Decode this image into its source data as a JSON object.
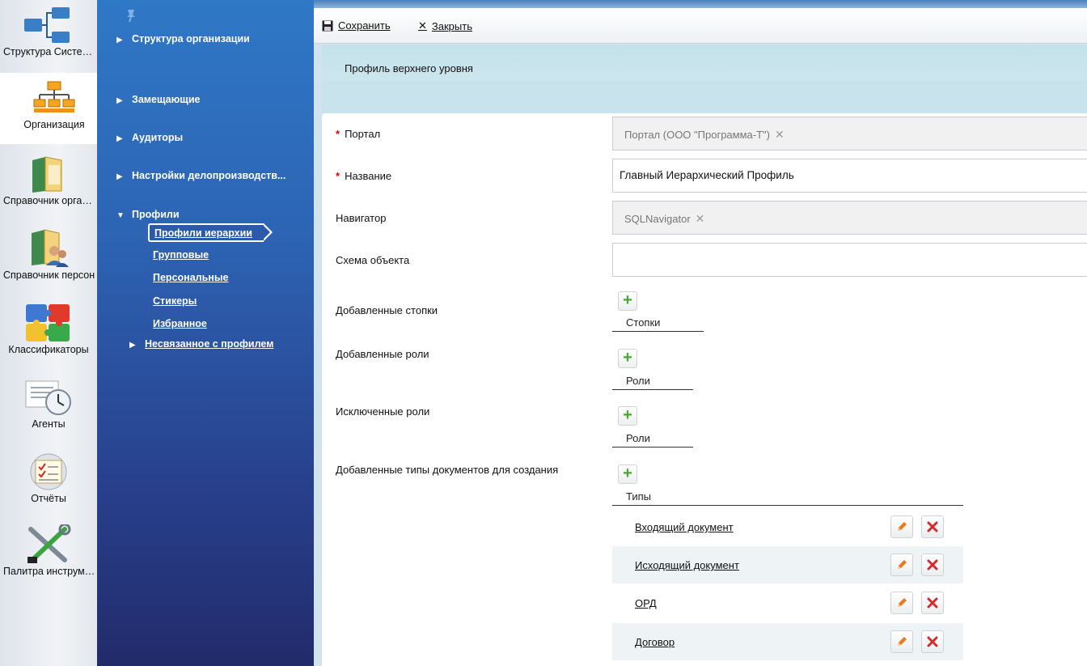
{
  "rail": {
    "items": [
      {
        "label": "Структура Системы",
        "icon": "system-structure-icon"
      },
      {
        "label": "Организация",
        "icon": "organization-chart-icon",
        "active": true
      },
      {
        "label": "Справочник организаций",
        "icon": "org-directory-icon"
      },
      {
        "label": "Справочник персон",
        "icon": "person-directory-icon"
      },
      {
        "label": "Классификаторы",
        "icon": "puzzle-icon"
      },
      {
        "label": "Агенты",
        "icon": "clock-agent-icon"
      },
      {
        "label": "Отчёты",
        "icon": "report-checklist-icon"
      },
      {
        "label": "Палитра инструментов",
        "icon": "tools-icon"
      }
    ]
  },
  "nav": {
    "sections": [
      {
        "label": "Структура организации"
      },
      {
        "label": "Замещающие"
      },
      {
        "label": "Аудиторы"
      },
      {
        "label": "Настройки делопроизводств..."
      },
      {
        "label": "Профили",
        "expanded": true
      }
    ],
    "profiles": [
      {
        "label": "Профили иерархии",
        "selected": true
      },
      {
        "label": "Групповые"
      },
      {
        "label": "Персональные"
      },
      {
        "label": "Стикеры"
      },
      {
        "label": "Избранное"
      }
    ],
    "unlinked": {
      "label": "Несвязанное с профилем"
    }
  },
  "toolbar": {
    "save_label": "Сохранить",
    "close_label": "Закрыть"
  },
  "header": {
    "title": "Профиль верхнего уровня"
  },
  "form": {
    "portal": {
      "label": "Портал",
      "value": "Портал (ООО \"Программа-Т\")",
      "required": true
    },
    "name": {
      "label": "Название",
      "value": "Главный Иерархический Профиль",
      "required": true
    },
    "navigator": {
      "label": "Навигатор",
      "value": "SQLNavigator"
    },
    "schema": {
      "label": "Схема объекта",
      "value": ""
    },
    "added_columns": {
      "label": "Добавленные стопки",
      "column": "Стопки"
    },
    "added_roles": {
      "label": "Добавленные роли",
      "column": "Роли"
    },
    "excluded_roles": {
      "label": "Исключенные роли",
      "column": "Роли"
    },
    "doc_types": {
      "label": "Добавленные типы документов для создания",
      "column": "Типы",
      "rows": [
        {
          "name": "Входящий документ"
        },
        {
          "name": "Исходящий документ"
        },
        {
          "name": "ОРД"
        },
        {
          "name": "Договор"
        }
      ]
    }
  },
  "colors": {
    "nav_top": "#2f78c6",
    "nav_bottom": "#222b6a",
    "required": "#dd0000",
    "plus": "#4aa832",
    "edit": "#e87a1a",
    "delete": "#d42a2a"
  }
}
